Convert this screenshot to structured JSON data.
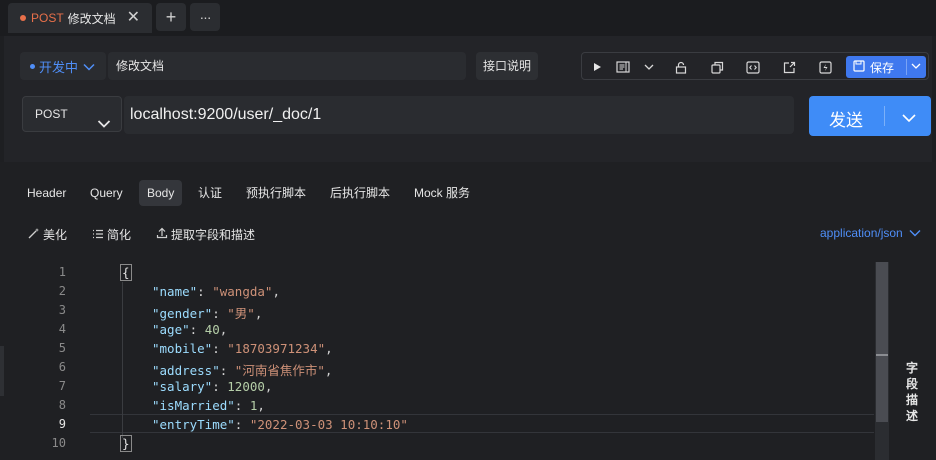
{
  "tabs": [
    {
      "method": "POST",
      "title": "修改文档",
      "close": "✕"
    }
  ],
  "tabbar": {
    "add": "+",
    "more": "···"
  },
  "header": {
    "status": "开发中",
    "doc_name": "修改文档",
    "api_desc": "接口说明",
    "save_label": "保存"
  },
  "request": {
    "method": "POST",
    "url": "localhost:9200/user/_doc/1",
    "send_label": "发送"
  },
  "req_tabs": [
    "Header",
    "Query",
    "Body",
    "认证",
    "预执行脚本",
    "后执行脚本",
    "Mock 服务"
  ],
  "active_tab": "Body",
  "body_tools": {
    "beautify": "美化",
    "simplify": "简化",
    "extract": "提取字段和描述",
    "content_type": "application/json"
  },
  "side_panel": {
    "label": "字段描述"
  },
  "editor": {
    "line_numbers": [
      "1",
      "2",
      "3",
      "4",
      "5",
      "6",
      "7",
      "8",
      "9",
      "10"
    ],
    "current_line": 9,
    "open_brace": "{",
    "close_brace": "}",
    "fields": [
      {
        "key": "\"name\"",
        "value": "\"wangda\"",
        "type": "string",
        "comma": ","
      },
      {
        "key": "\"gender\"",
        "value": "\"男\"",
        "type": "string",
        "comma": ","
      },
      {
        "key": "\"age\"",
        "value": "40",
        "type": "number",
        "comma": ","
      },
      {
        "key": "\"mobile\"",
        "value": "\"18703971234\"",
        "type": "string",
        "comma": ","
      },
      {
        "key": "\"address\"",
        "value": "\"河南省焦作市\"",
        "type": "string",
        "comma": ","
      },
      {
        "key": "\"salary\"",
        "value": "12000",
        "type": "number",
        "comma": ","
      },
      {
        "key": "\"isMarried\"",
        "value": "1",
        "type": "number",
        "comma": ","
      },
      {
        "key": "\"entryTime\"",
        "value": "\"2022-03-03 10:10:10\"",
        "type": "string",
        "comma": ""
      }
    ]
  },
  "colors": {
    "accent": "#3f8cf7",
    "method_post": "#e8704a",
    "json_key": "#9cdcfe",
    "json_string": "#ce9178",
    "json_number": "#b5cea8"
  }
}
